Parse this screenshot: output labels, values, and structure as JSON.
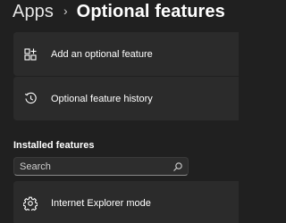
{
  "breadcrumb": {
    "parent": "Apps",
    "separator": "›",
    "current": "Optional features"
  },
  "actions": [
    {
      "label": "Add an optional feature",
      "icon": "add-grid-icon"
    },
    {
      "label": "Optional feature history",
      "icon": "history-icon"
    }
  ],
  "installed": {
    "title": "Installed features",
    "search": {
      "placeholder": "Search",
      "value": "",
      "icon": "search-icon"
    },
    "items": [
      {
        "label": "Internet Explorer mode",
        "icon": "gear-icon"
      }
    ]
  },
  "colors": {
    "background": "#202020",
    "card": "#2b2b2b",
    "text": "#ffffff"
  }
}
